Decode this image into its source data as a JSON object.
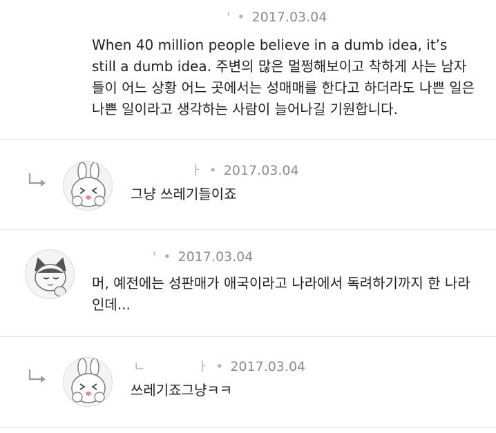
{
  "comments": [
    {
      "name_fragment": "'",
      "date": "2017.03.04",
      "text": "When 40 million people believe in a dumb idea, it’s still a dumb idea. 주변의 많은 멀쩡해보이고 착하게 사는 남자들이 어느 상황 어느 곳에서는 성매매를 한다고 하더라도 나쁜 일은 나쁜 일이라고 생각하는 사람이 늘어나길 기원합니다."
    },
    {
      "name_fragment": "ㅏ",
      "date": "2017.03.04",
      "text": "그냥 쓰레기들이죠",
      "avatar_icon": "bunny-avatar-icon",
      "is_reply": true
    },
    {
      "name_fragment": "'",
      "date": "2017.03.04",
      "text": "머, 예전에는 성판매가 애국이라고 나라에서 독려하기까지 한 나라인데...",
      "avatar_icon": "cat-avatar-icon"
    },
    {
      "name_fragment_start": "ㄴ",
      "name_fragment": "ㅏ",
      "date": "2017.03.04",
      "text": "쓰레기죠그냥ㅋㅋ",
      "avatar_icon": "bunny-avatar-icon",
      "is_reply": true
    }
  ],
  "separator_dot": "•"
}
